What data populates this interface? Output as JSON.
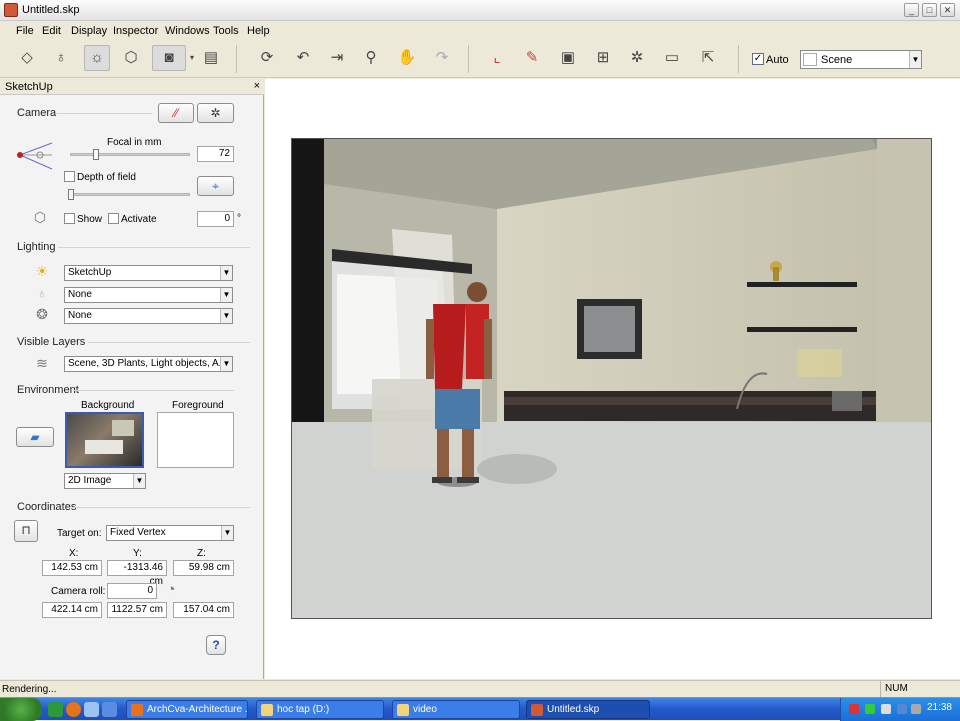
{
  "window": {
    "title": "Untitled.skp",
    "controls": [
      "_",
      "□",
      "✕"
    ]
  },
  "menu": [
    "File",
    "Edit",
    "Display",
    "Inspector",
    "Windows",
    "Tools",
    "Help"
  ],
  "toolbar": {
    "icons": [
      "paint-bucket-icon",
      "lightbulb-icon",
      "sun-icon",
      "cube-icon",
      "camera-icon",
      "document-icon",
      "orbit-icon",
      "undo-icon",
      "zoom-extents-icon",
      "zoom-icon",
      "pan-hand-icon",
      "redo-icon",
      "frame-icon",
      "color-picker-icon",
      "render-camera-icon",
      "crop-icon",
      "gear-icon",
      "window-icon",
      "export-icon"
    ],
    "auto_label": "Auto",
    "auto_checked": true,
    "scene_value": "Scene"
  },
  "panel": {
    "title": "SketchUp",
    "close": "×",
    "camera": {
      "heading": "Camera",
      "focal_label": "Focal in mm",
      "focal_value": "72",
      "dof_label": "Depth of field",
      "show_label": "Show",
      "activate_label": "Activate",
      "angle_value": "0",
      "degree": "°"
    },
    "lighting": {
      "heading": "Lighting",
      "sun_value": "SketchUp",
      "lamp_value": "None",
      "emitter_value": "None"
    },
    "layers": {
      "heading": "Visible Layers",
      "value": "Scene, 3D Plants, Light objects, A..."
    },
    "environment": {
      "heading": "Environment",
      "background_label": "Background",
      "foreground_label": "Foreground",
      "bg_type": "2D Image"
    },
    "coordinates": {
      "heading": "Coordinates",
      "target_label": "Target on:",
      "target_value": "Fixed Vertex",
      "x_label": "X:",
      "y_label": "Y:",
      "z_label": "Z:",
      "x": "142.53 cm",
      "y": "-1313.46 cm",
      "z": "59.98 cm",
      "roll_label": "Camera roll:",
      "roll_value": "0",
      "x2": "422.14 cm",
      "y2": "1122.57 cm",
      "z2": "157.04 cm",
      "help": "?"
    }
  },
  "status": {
    "text": "Rendering...",
    "num": "NUM"
  },
  "taskbar": {
    "tasks": [
      {
        "label": "ArchCva-Architecture ...",
        "color": "#e8721c"
      },
      {
        "label": "hoc tap (D:)",
        "color": "#f2d27a"
      },
      {
        "label": "video",
        "color": "#f2d27a"
      },
      {
        "label": "Untitled.skp",
        "color": "#cf5a3a"
      }
    ],
    "clock": "21:38"
  }
}
